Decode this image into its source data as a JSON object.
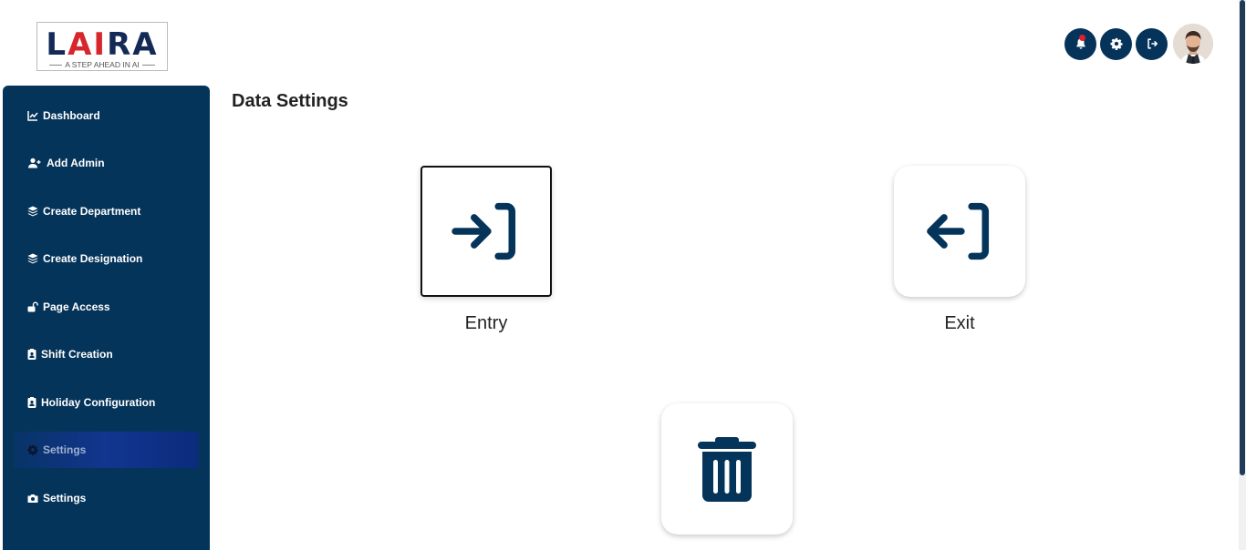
{
  "brand": {
    "logo_text_navy1": "L",
    "logo_text_red": "AI",
    "logo_text_navy2": "RA",
    "tagline": "A STEP AHEAD IN AI"
  },
  "header": {
    "icons": [
      "bell-icon",
      "gear-icon",
      "logout-icon",
      "avatar"
    ],
    "notification_dot_color": "#e0202a"
  },
  "sidebar": {
    "items": [
      {
        "label": "Dashboard",
        "icon": "chart-line-icon"
      },
      {
        "label": "Add Admin",
        "icon": "user-plus-icon"
      },
      {
        "label": "Create Department",
        "icon": "layers-icon"
      },
      {
        "label": "Create Designation",
        "icon": "layers-icon"
      },
      {
        "label": "Page Access",
        "icon": "unlock-icon"
      },
      {
        "label": "Shift Creation",
        "icon": "id-badge-icon"
      },
      {
        "label": "Holiday Configuration",
        "icon": "id-badge-icon"
      },
      {
        "label": "Settings",
        "icon": "gear-icon",
        "active": true
      },
      {
        "label": "Settings",
        "icon": "camera-icon"
      }
    ]
  },
  "main": {
    "title": "Data Settings",
    "tiles": [
      {
        "label": "Entry",
        "icon": "sign-in-icon"
      },
      {
        "label": "Exit",
        "icon": "sign-out-icon"
      },
      {
        "label": "",
        "icon": "trash-icon"
      }
    ]
  },
  "colors": {
    "navy": "#05345a",
    "active_gradient": "#12358f",
    "brand_red": "#d7262c"
  }
}
